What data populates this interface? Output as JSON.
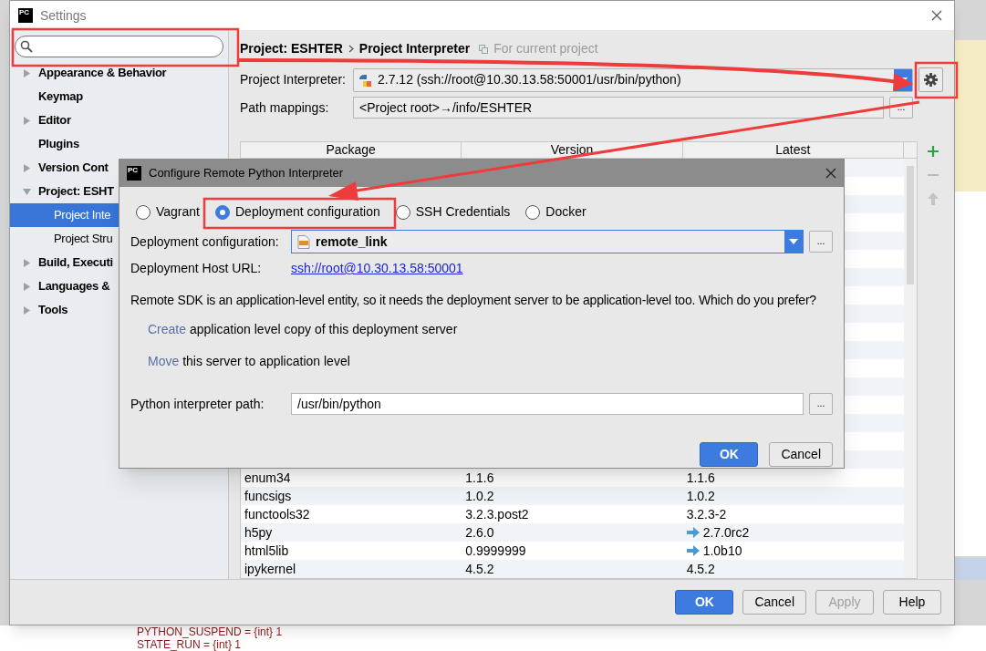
{
  "window": {
    "logo": "PC",
    "title": "Settings"
  },
  "sidebar": {
    "items": [
      {
        "label": "Appearance & Behavior",
        "kind": "group",
        "expanded": false,
        "selected": false
      },
      {
        "label": "Keymap",
        "kind": "page",
        "selected": false
      },
      {
        "label": "Editor",
        "kind": "group",
        "expanded": false,
        "selected": false
      },
      {
        "label": "Plugins",
        "kind": "page",
        "selected": false
      },
      {
        "label": "Version Cont",
        "kind": "group",
        "expanded": false,
        "selected": false
      },
      {
        "label": "Project: ESHT",
        "kind": "group",
        "expanded": true,
        "selected": false,
        "children": [
          {
            "label": "Project Inte",
            "selected": true
          },
          {
            "label": "Project Stru",
            "selected": false
          }
        ]
      },
      {
        "label": "Build, Executi",
        "kind": "group",
        "expanded": false,
        "selected": false
      },
      {
        "label": "Languages &",
        "kind": "group",
        "expanded": false,
        "selected": false
      },
      {
        "label": "Tools",
        "kind": "group",
        "expanded": false,
        "selected": false
      }
    ]
  },
  "breadcrumb": {
    "path": [
      "Project: ESHTER",
      "Project Interpreter"
    ],
    "note": "For current project"
  },
  "interpreter": {
    "label": "Project Interpreter:",
    "value": "2.7.12 (ssh://root@10.30.13.58:50001/usr/bin/python)"
  },
  "path_mappings": {
    "label": "Path mappings:",
    "value": "<Project root>→/info/ESHTER",
    "button": "..."
  },
  "table": {
    "columns": [
      "Package",
      "Version",
      "Latest"
    ],
    "rows": [
      {
        "package": "enum34",
        "version": "1.1.6",
        "latest": "1.1.6",
        "upgrade": false
      },
      {
        "package": "funcsigs",
        "version": "1.0.2",
        "latest": "1.0.2",
        "upgrade": false
      },
      {
        "package": "functools32",
        "version": "3.2.3.post2",
        "latest": "3.2.3-2",
        "upgrade": false
      },
      {
        "package": "h5py",
        "version": "2.6.0",
        "latest": "2.7.0rc2",
        "upgrade": true
      },
      {
        "package": "html5lib",
        "version": "0.9999999",
        "latest": "1.0b10",
        "upgrade": true
      },
      {
        "package": "ipykernel",
        "version": "4.5.2",
        "latest": "4.5.2",
        "upgrade": false
      }
    ]
  },
  "buttons": [
    {
      "label": "OK",
      "kind": "primary",
      "disabled": false
    },
    {
      "label": "Cancel",
      "kind": "default",
      "disabled": false
    },
    {
      "label": "Apply",
      "kind": "default",
      "disabled": true
    },
    {
      "label": "Help",
      "kind": "default",
      "disabled": false
    }
  ],
  "dialog": {
    "logo": "PC",
    "title": "Configure Remote Python Interpreter",
    "options": [
      {
        "label": "Vagrant",
        "selected": false
      },
      {
        "label": "Deployment configuration",
        "selected": true
      },
      {
        "label": "SSH Credentials",
        "selected": false
      },
      {
        "label": "Docker",
        "selected": false
      }
    ],
    "config": {
      "label": "Deployment configuration:",
      "value": "remote_link",
      "button": "..."
    },
    "host": {
      "label": "Deployment Host URL:",
      "url": "ssh://root@10.30.13.58:50001"
    },
    "message": "Remote SDK is an application-level entity, so it needs the deployment server to be application-level too. Which do you prefer?",
    "choices": [
      {
        "link": "Create",
        "text": "application level copy of this deployment server"
      },
      {
        "link": "Move",
        "text": "this server to application level"
      }
    ],
    "interpreter_path": {
      "label": "Python interpreter path:",
      "value": "/usr/bin/python",
      "button": "..."
    },
    "buttons": [
      {
        "label": "OK",
        "kind": "primary"
      },
      {
        "label": "Cancel",
        "kind": "default"
      }
    ]
  },
  "background": {
    "lines": [
      "PYTHON_SUSPEND = {int} 1",
      "STATE_RUN = {int} 1"
    ]
  }
}
